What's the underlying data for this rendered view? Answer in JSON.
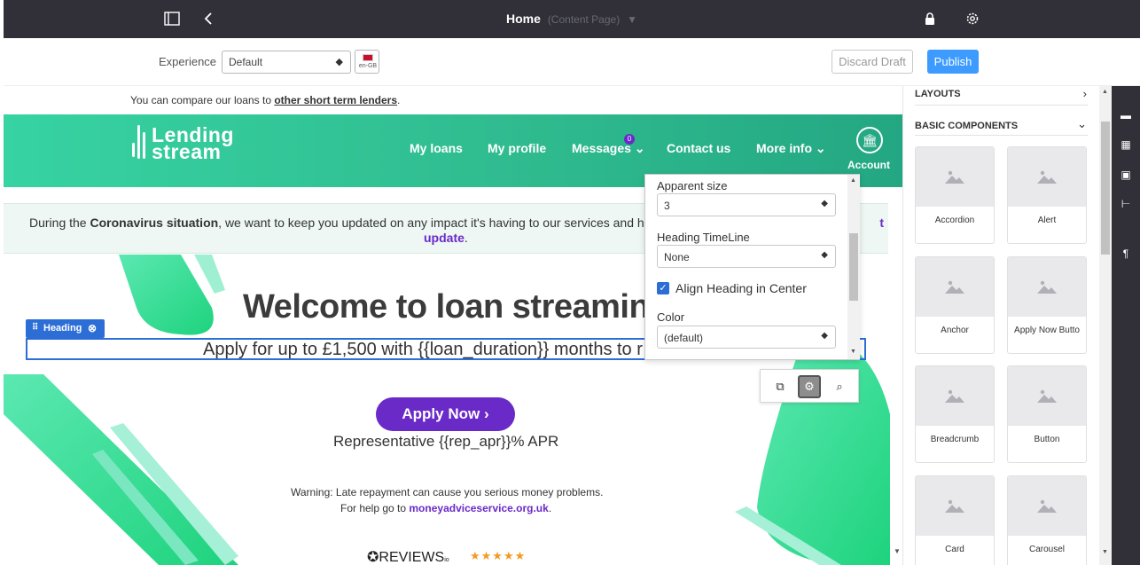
{
  "topbar": {
    "page_title": "Home",
    "page_type": "(Content Page)"
  },
  "subbar": {
    "experience_label": "Experience",
    "experience_value": "Default",
    "locale_code": "en-GB",
    "discard_label": "Discard Draft",
    "publish_label": "Publish"
  },
  "page": {
    "compare_prefix": "You can compare our loans to ",
    "compare_link": "other short term lenders",
    "compare_suffix": ".",
    "logo_line1": "Lending",
    "logo_line2": "stream",
    "nav": [
      "My loans",
      "My profile",
      "Messages",
      "Contact us",
      "More info"
    ],
    "messages_count": "0",
    "account_label": "Account",
    "notice_prefix": "During the ",
    "notice_bold": "Coronavirus situation",
    "notice_middle": ", we want to keep you updated on any impact it's having to our services and how t",
    "notice_trail": "t",
    "notice_link": "update",
    "notice_end": ".",
    "welcome": "Welcome to loan streaming",
    "heading_tag": "Heading",
    "apply_text": "Apply for up to £1,500 with {{loan_duration}} months to r",
    "apply_button": "Apply Now",
    "rep_apr": "Representative {{rep_apr}}% APR",
    "warning_line1": "Warning: Late repayment can cause you serious money problems.",
    "warning_prefix": "For help go to ",
    "warning_link": "moneyadviceservice.org.uk",
    "warning_suffix": ".",
    "reviews_logo": "REVIEWS",
    "reviews_suffix": "io",
    "stars": "★★★★★"
  },
  "popover": {
    "apparent_size_label": "Apparent size",
    "apparent_size_value": "3",
    "heading_timeline_label": "Heading TimeLine",
    "heading_timeline_value": "None",
    "align_center_label": "Align Heading in Center",
    "align_center_checked": true,
    "color_label": "Color",
    "color_value": "(default)"
  },
  "panel": {
    "layouts_label": "LAYOUTS",
    "basic_components_label": "BASIC COMPONENTS",
    "components": [
      "Accordion",
      "Alert",
      "Anchor",
      "Apply Now Butto",
      "Breadcrumb",
      "Button",
      "Card",
      "Carousel"
    ]
  },
  "colors": {
    "brand_green": "#2fba8e",
    "brand_purple": "#6a2ac8",
    "publish_blue": "#3d9bff",
    "selection_blue": "#2c6dd6",
    "topbar_dark": "#313038"
  }
}
